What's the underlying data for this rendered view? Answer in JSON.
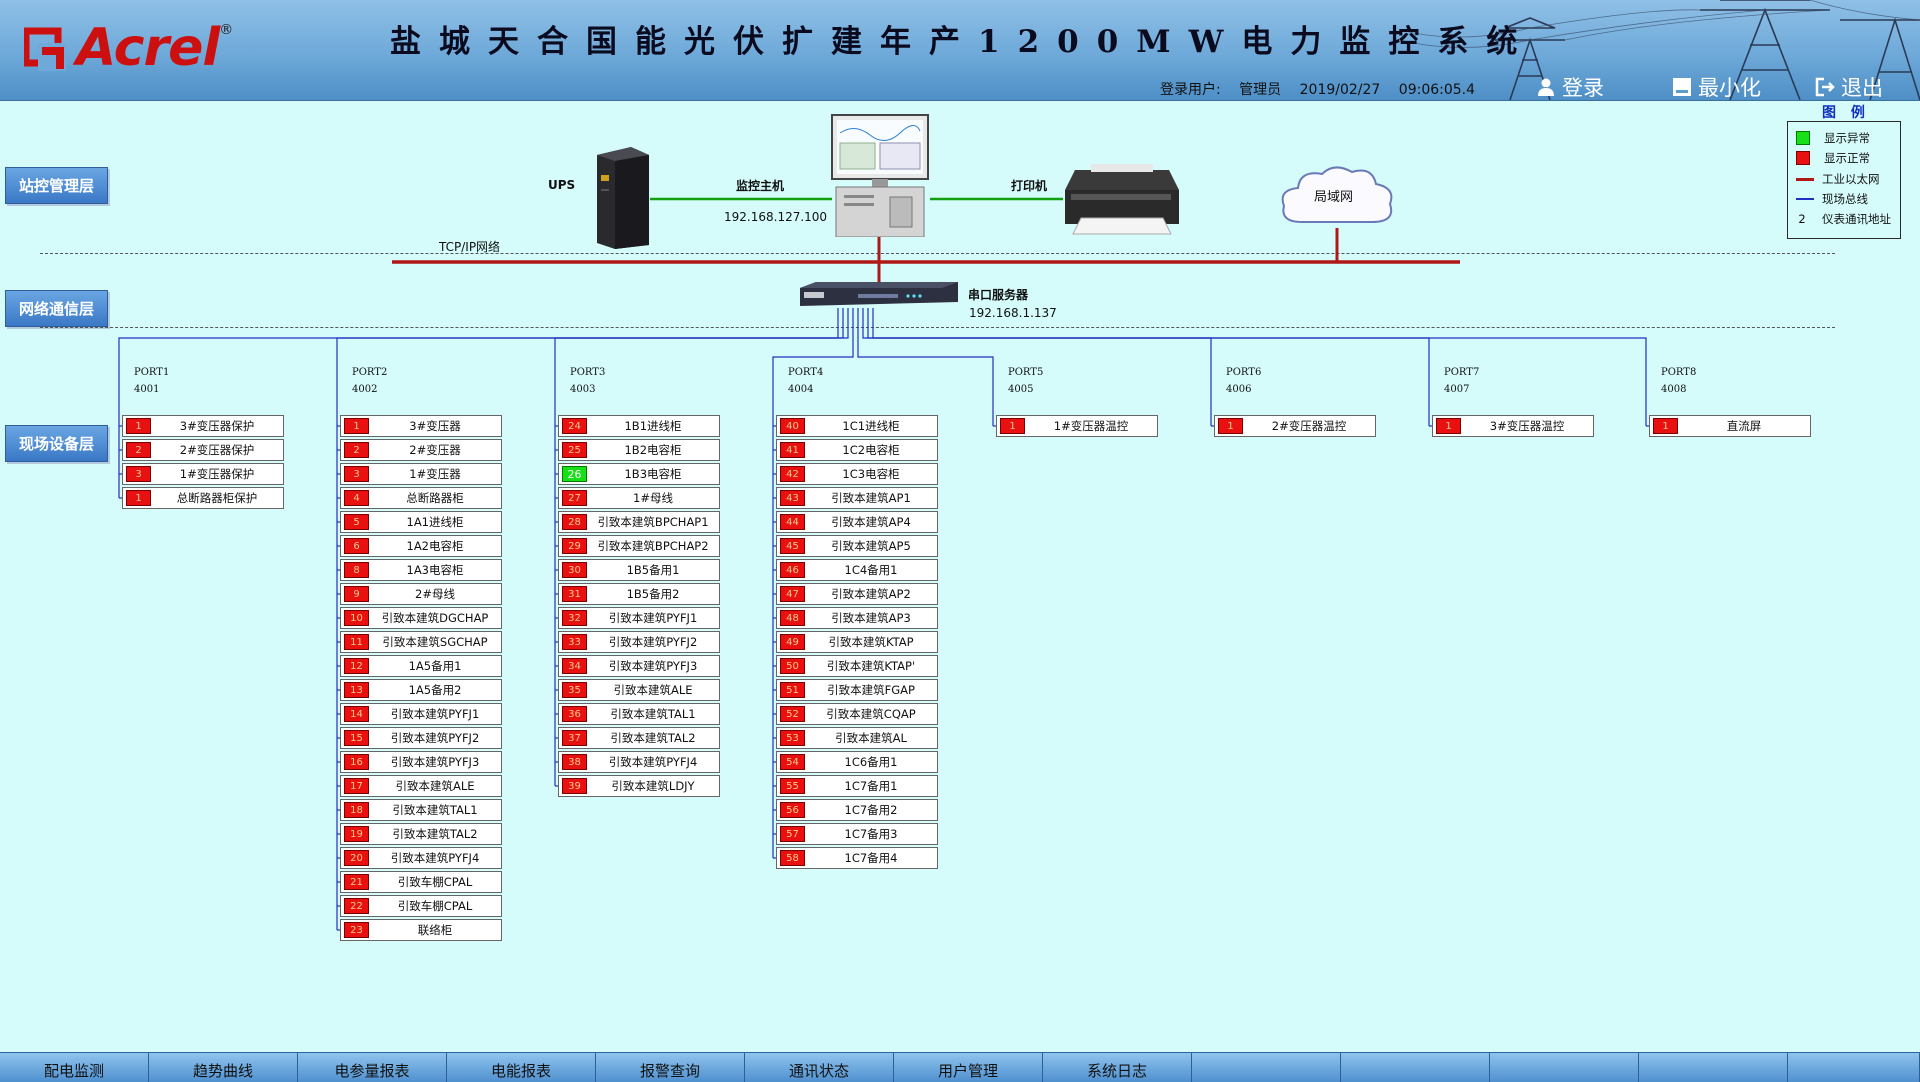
{
  "header": {
    "logo_text": "Acrel",
    "logo_reg": "®",
    "title": "盐城天合国能光伏扩建年产1200MW电力监控系统",
    "login_label": "登录用户:",
    "user": "管理员",
    "date": "2019/02/27",
    "time": "09:06:05.4",
    "login_btn": "登录",
    "minimize_btn": "最小化",
    "exit_btn": "退出"
  },
  "layers": {
    "station": "站控管理层",
    "network": "网络通信层",
    "field": "现场设备层"
  },
  "topology": {
    "ups": "UPS",
    "host": "监控主机",
    "host_ip": "192.168.127.100",
    "printer": "打印机",
    "lan": "局域网",
    "tcpip": "TCP/IP网络",
    "serial_server": "串口服务器",
    "serial_ip": "192.168.1.137"
  },
  "legend": {
    "title": "图 例",
    "items": [
      {
        "label": "显示异常"
      },
      {
        "label": "显示正常"
      },
      {
        "label": "工业以太网"
      },
      {
        "label": "现场总线"
      },
      {
        "label": "仪表通讯地址",
        "symbol": "2"
      }
    ]
  },
  "colors": {
    "status_fault": "#e81010",
    "status_ok": "#18e018",
    "ethernet": "#b01818",
    "fieldbus": "#2030c0",
    "link_green": "#10a010"
  },
  "ports": [
    {
      "name": "PORT1",
      "num": "4001",
      "devices": [
        {
          "addr": "1",
          "name": "3#变压器保护",
          "ok": false
        },
        {
          "addr": "2",
          "name": "2#变压器保护",
          "ok": false
        },
        {
          "addr": "3",
          "name": "1#变压器保护",
          "ok": false
        },
        {
          "addr": "1",
          "name": "总断路器柜保护",
          "ok": false
        }
      ]
    },
    {
      "name": "PORT2",
      "num": "4002",
      "devices": [
        {
          "addr": "1",
          "name": "3#变压器",
          "ok": false
        },
        {
          "addr": "2",
          "name": "2#变压器",
          "ok": false
        },
        {
          "addr": "3",
          "name": "1#变压器",
          "ok": false
        },
        {
          "addr": "4",
          "name": "总断路器柜",
          "ok": false
        },
        {
          "addr": "5",
          "name": "1A1进线柜",
          "ok": false
        },
        {
          "addr": "6",
          "name": "1A2电容柜",
          "ok": false
        },
        {
          "addr": "8",
          "name": "1A3电容柜",
          "ok": false
        },
        {
          "addr": "9",
          "name": "2#母线",
          "ok": false
        },
        {
          "addr": "10",
          "name": "引致本建筑DGCHAP",
          "ok": false
        },
        {
          "addr": "11",
          "name": "引致本建筑SGCHAP",
          "ok": false
        },
        {
          "addr": "12",
          "name": "1A5备用1",
          "ok": false
        },
        {
          "addr": "13",
          "name": "1A5备用2",
          "ok": false
        },
        {
          "addr": "14",
          "name": "引致本建筑PYFJ1",
          "ok": false
        },
        {
          "addr": "15",
          "name": "引致本建筑PYFJ2",
          "ok": false
        },
        {
          "addr": "16",
          "name": "引致本建筑PYFJ3",
          "ok": false
        },
        {
          "addr": "17",
          "name": "引致本建筑ALE",
          "ok": false
        },
        {
          "addr": "18",
          "name": "引致本建筑TAL1",
          "ok": false
        },
        {
          "addr": "19",
          "name": "引致本建筑TAL2",
          "ok": false
        },
        {
          "addr": "20",
          "name": "引致本建筑PYFJ4",
          "ok": false
        },
        {
          "addr": "21",
          "name": "引致车棚CPAL",
          "ok": false
        },
        {
          "addr": "22",
          "name": "引致车棚CPAL",
          "ok": false
        },
        {
          "addr": "23",
          "name": "联络柜",
          "ok": false
        }
      ]
    },
    {
      "name": "PORT3",
      "num": "4003",
      "devices": [
        {
          "addr": "24",
          "name": "1B1进线柜",
          "ok": false
        },
        {
          "addr": "25",
          "name": "1B2电容柜",
          "ok": false
        },
        {
          "addr": "26",
          "name": "1B3电容柜",
          "ok": true
        },
        {
          "addr": "27",
          "name": "1#母线",
          "ok": false
        },
        {
          "addr": "28",
          "name": "引致本建筑BPCHAP1",
          "ok": false
        },
        {
          "addr": "29",
          "name": "引致本建筑BPCHAP2",
          "ok": false
        },
        {
          "addr": "30",
          "name": "1B5备用1",
          "ok": false
        },
        {
          "addr": "31",
          "name": "1B5备用2",
          "ok": false
        },
        {
          "addr": "32",
          "name": "引致本建筑PYFJ1",
          "ok": false
        },
        {
          "addr": "33",
          "name": "引致本建筑PYFJ2",
          "ok": false
        },
        {
          "addr": "34",
          "name": "引致本建筑PYFJ3",
          "ok": false
        },
        {
          "addr": "35",
          "name": "引致本建筑ALE",
          "ok": false
        },
        {
          "addr": "36",
          "name": "引致本建筑TAL1",
          "ok": false
        },
        {
          "addr": "37",
          "name": "引致本建筑TAL2",
          "ok": false
        },
        {
          "addr": "38",
          "name": "引致本建筑PYFJ4",
          "ok": false
        },
        {
          "addr": "39",
          "name": "引致本建筑LDJY",
          "ok": false
        }
      ]
    },
    {
      "name": "PORT4",
      "num": "4004",
      "devices": [
        {
          "addr": "40",
          "name": "1C1进线柜",
          "ok": false
        },
        {
          "addr": "41",
          "name": "1C2电容柜",
          "ok": false
        },
        {
          "addr": "42",
          "name": "1C3电容柜",
          "ok": false
        },
        {
          "addr": "43",
          "name": "引致本建筑AP1",
          "ok": false
        },
        {
          "addr": "44",
          "name": "引致本建筑AP4",
          "ok": false
        },
        {
          "addr": "45",
          "name": "引致本建筑AP5",
          "ok": false
        },
        {
          "addr": "46",
          "name": "1C4备用1",
          "ok": false
        },
        {
          "addr": "47",
          "name": "引致本建筑AP2",
          "ok": false
        },
        {
          "addr": "48",
          "name": "引致本建筑AP3",
          "ok": false
        },
        {
          "addr": "49",
          "name": "引致本建筑KTAP",
          "ok": false
        },
        {
          "addr": "50",
          "name": "引致本建筑KTAP'",
          "ok": false
        },
        {
          "addr": "51",
          "name": "引致本建筑FGAP",
          "ok": false
        },
        {
          "addr": "52",
          "name": "引致本建筑CQAP",
          "ok": false
        },
        {
          "addr": "53",
          "name": "引致本建筑AL",
          "ok": false
        },
        {
          "addr": "54",
          "name": "1C6备用1",
          "ok": false
        },
        {
          "addr": "55",
          "name": "1C7备用1",
          "ok": false
        },
        {
          "addr": "56",
          "name": "1C7备用2",
          "ok": false
        },
        {
          "addr": "57",
          "name": "1C7备用3",
          "ok": false
        },
        {
          "addr": "58",
          "name": "1C7备用4",
          "ok": false
        }
      ]
    },
    {
      "name": "PORT5",
      "num": "4005",
      "devices": [
        {
          "addr": "1",
          "name": "1#变压器温控",
          "ok": false
        }
      ]
    },
    {
      "name": "PORT6",
      "num": "4006",
      "devices": [
        {
          "addr": "1",
          "name": "2#变压器温控",
          "ok": false
        }
      ]
    },
    {
      "name": "PORT7",
      "num": "4007",
      "devices": [
        {
          "addr": "1",
          "name": "3#变压器温控",
          "ok": false
        }
      ]
    },
    {
      "name": "PORT8",
      "num": "4008",
      "devices": [
        {
          "addr": "1",
          "name": "直流屏",
          "ok": false
        }
      ]
    }
  ],
  "bottom_nav": [
    "配电监测",
    "趋势曲线",
    "电参量报表",
    "电能报表",
    "报警查询",
    "通讯状态",
    "用户管理",
    "系统日志",
    "",
    "",
    "",
    "",
    ""
  ]
}
